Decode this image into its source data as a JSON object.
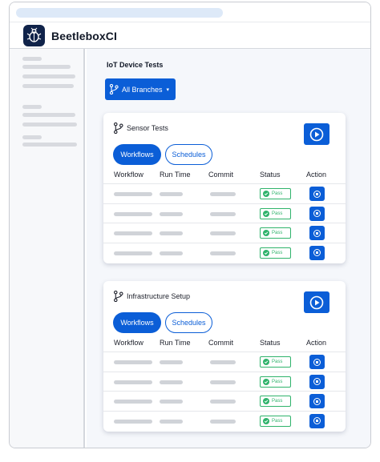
{
  "brand": {
    "name": "BeetleboxCI",
    "logo_icon": "beetle-icon"
  },
  "page": {
    "title": "IoT Device Tests"
  },
  "branch_selector": {
    "label": "All Branches",
    "icon": "git-branch-icon",
    "caret": "▾"
  },
  "columns": [
    "Workflow",
    "Run Time",
    "Commit",
    "Status",
    "Action"
  ],
  "tabs": {
    "workflows": "Workflows",
    "schedules": "Schedules"
  },
  "pipelines": [
    {
      "title": "Sensor Tests",
      "rows": [
        {
          "status": "Pass"
        },
        {
          "status": "Pass"
        },
        {
          "status": "Pass"
        },
        {
          "status": "Pass"
        }
      ]
    },
    {
      "title": "Infrastructure Setup",
      "rows": [
        {
          "status": "Pass"
        },
        {
          "status": "Pass"
        },
        {
          "status": "Pass"
        },
        {
          "status": "Pass"
        }
      ]
    }
  ],
  "colors": {
    "accent": "#0b5ed7",
    "pass": "#2fb36b",
    "logo_bg": "#10234a"
  }
}
